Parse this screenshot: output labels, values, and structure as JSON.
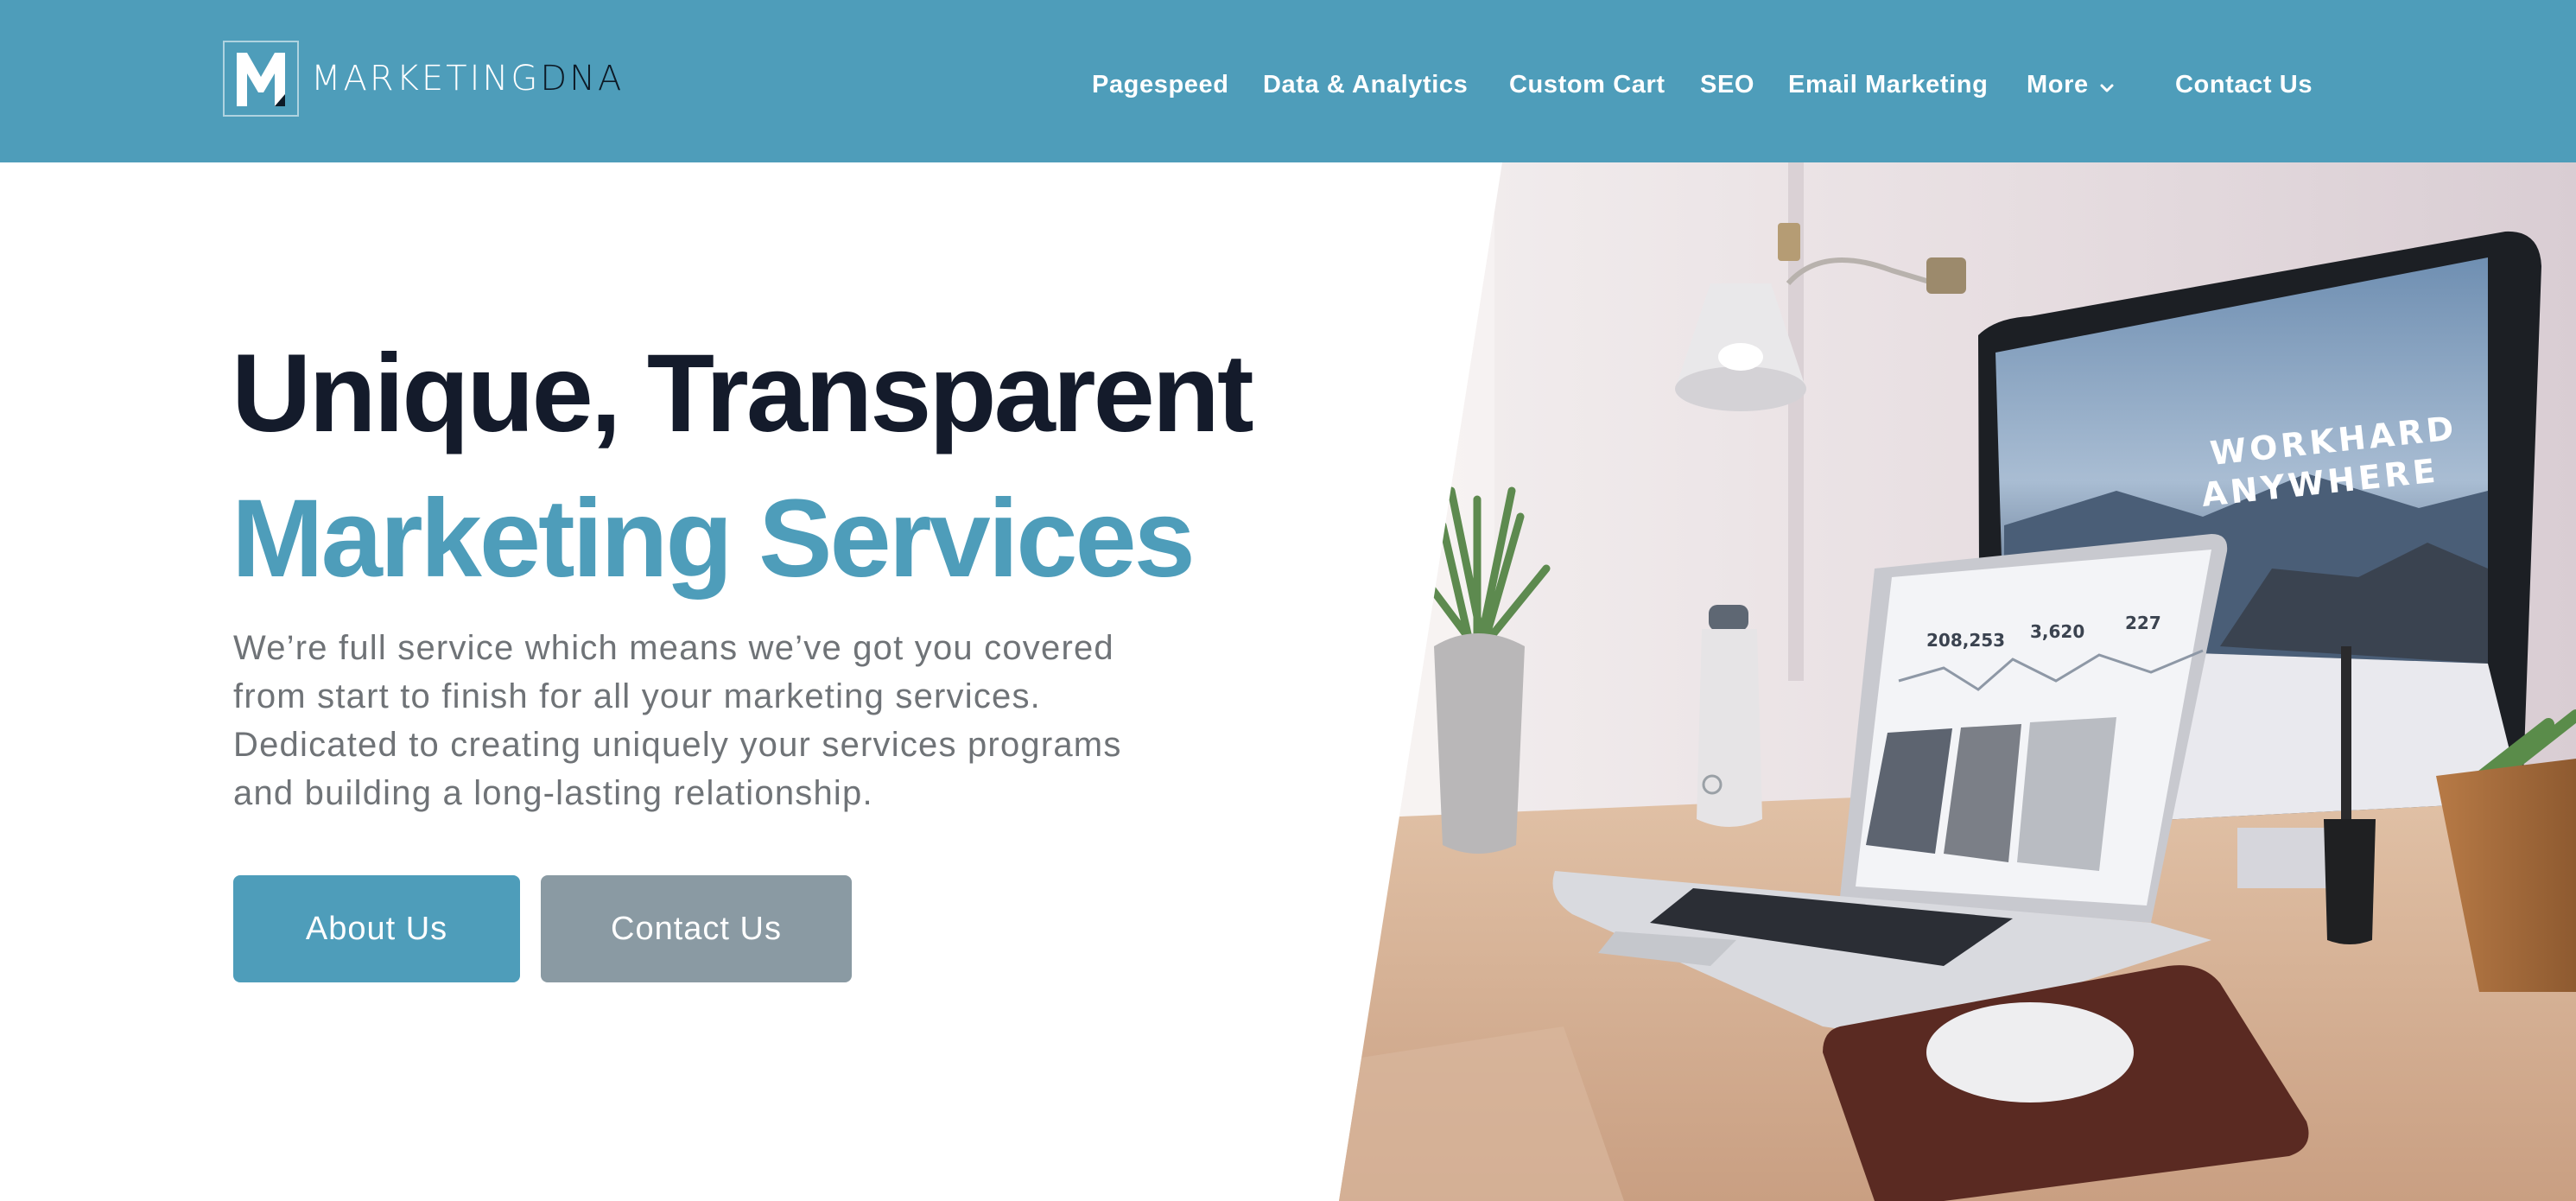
{
  "header": {
    "logo": {
      "word_main": "MARKETING",
      "word_accent": "DNA"
    },
    "nav": [
      {
        "label": "Pagespeed"
      },
      {
        "label": "Data & Analytics"
      },
      {
        "label": "Custom Cart"
      },
      {
        "label": "SEO"
      },
      {
        "label": "Email Marketing"
      },
      {
        "label": "More",
        "icon": "chevron-down-icon"
      },
      {
        "label": "Contact Us"
      }
    ]
  },
  "hero": {
    "title_line_1": "Unique, Transparent",
    "title_line_2": "Marketing Services",
    "body": "We’re full service which means we’ve got you covered from start to finish for all your marketing services. Dedicated to creating uniquely your services programs and building a long-lasting relationship.",
    "buttons": {
      "primary": "About Us",
      "secondary": "Contact Us"
    },
    "image": {
      "screen_text_line_1": "WORKHARD",
      "screen_text_line_2": "ANYWHERE",
      "stats": [
        "208,253",
        "3,620",
        "227"
      ]
    }
  },
  "colors": {
    "brand": "#4e9dba",
    "heading": "#141b2b",
    "body_text": "#6f7377",
    "secondary_button": "#8a9aa3"
  }
}
